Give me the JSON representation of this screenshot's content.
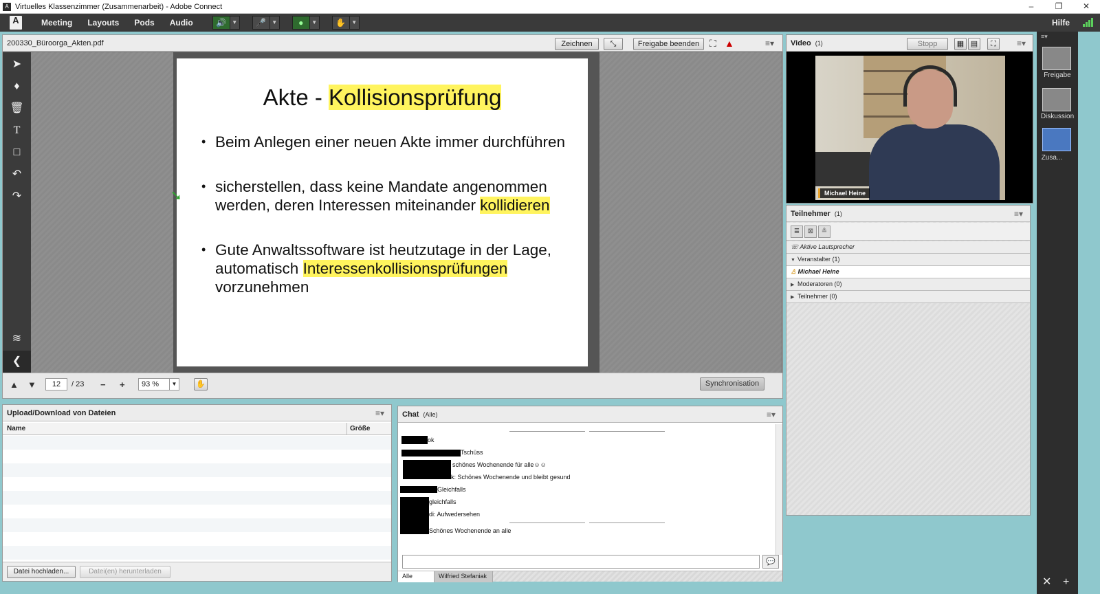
{
  "window": {
    "title": "Virtuelles Klassenzimmer (Zusammenarbeit) - Adobe Connect",
    "minimize": "–",
    "restore": "❐",
    "close": "✕"
  },
  "menubar": {
    "logo": "A",
    "items": [
      "Meeting",
      "Layouts",
      "Pods",
      "Audio"
    ],
    "help": "Hilfe"
  },
  "share": {
    "filename": "200330_Büroorga_Akten.pdf",
    "draw_button": "Zeichnen",
    "stop_share_button": "Freigabe beenden",
    "menu_glyph": "≡▾",
    "page_current": "12",
    "page_total": "/ 23",
    "zoom": "93 %",
    "sync_button": "Synchronisation"
  },
  "slide": {
    "title_plain": "Akte - ",
    "title_highlight": "Kollisionsprüfung",
    "bullet1": "Beim Anlegen einer neuen Akte immer durchführen",
    "bullet2_plain": "sicherstellen, dass keine Mandate angenommen werden, deren Interessen miteinander ",
    "bullet2_highlight": "kollidieren",
    "bullet3_plain": "Gute Anwaltssoftware ist heutzutage in der Lage, automatisch ",
    "bullet3_highlight": "Interessenkollisionsprüfungen",
    "bullet3_tail": " vorzunehmen"
  },
  "video": {
    "title": "Video",
    "count": "(1)",
    "stop_button": "Stopp",
    "person_name": "Michael Heine"
  },
  "attendees": {
    "title": "Teilnehmer",
    "count": "(1)",
    "active_speakers": "Aktive Lautsprecher",
    "hosts": "Veranstalter (1)",
    "host_name": "Michael Heine",
    "presenters": "Moderatoren (0)",
    "participants": "Teilnehmer (0)"
  },
  "layouts": {
    "items": [
      "Freigabe",
      "Diskussion",
      "Zusa..."
    ]
  },
  "files": {
    "title": "Upload/Download von Dateien",
    "col_name": "Name",
    "col_size": "Größe",
    "upload_button": "Datei hochladen...",
    "download_button": "Datei(en) herunterladen"
  },
  "chat": {
    "title": "Chat",
    "scope": "(Alle)",
    "messages": [
      "ok",
      "Tschüss",
      "schönes Wochenende für alle",
      "k: Schönes Wochenende und bleibt gesund",
      "Gleichfalls",
      "gleichfalls",
      "di: Aufwedersehen",
      "Schönes Wochenende an alle"
    ],
    "tab_all": "Alle",
    "tab_user": "Wilfried Stefaniak"
  }
}
